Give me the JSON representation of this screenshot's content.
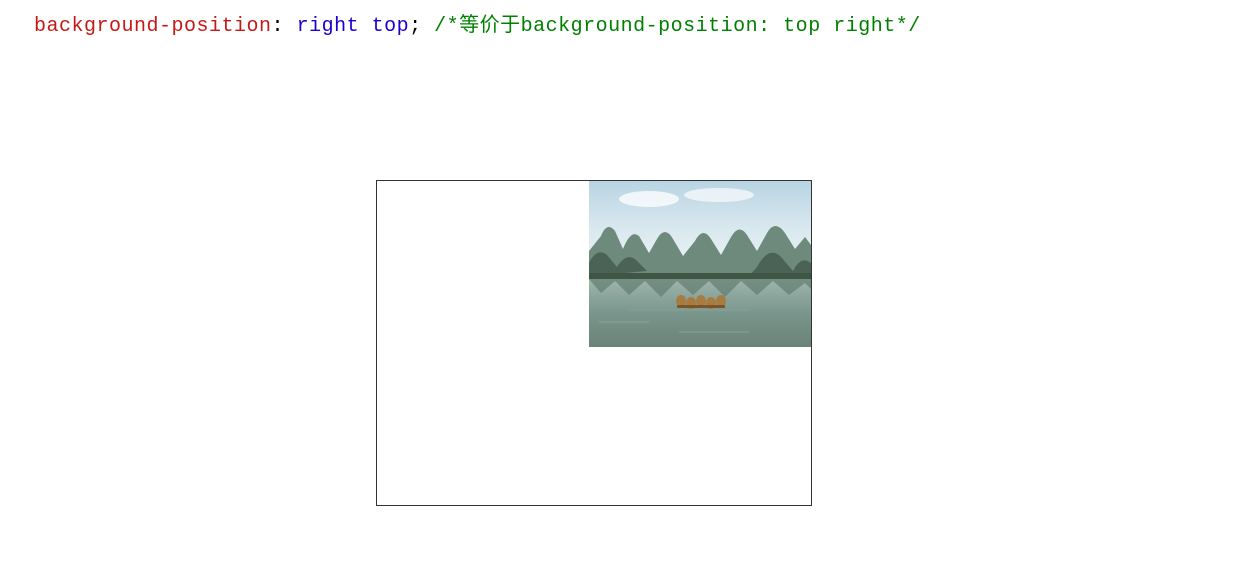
{
  "code": {
    "property": "background-position",
    "colon": ":",
    "value": "right top",
    "semicolon": ";",
    "comment": "/*等价于background-position: top right*/"
  }
}
